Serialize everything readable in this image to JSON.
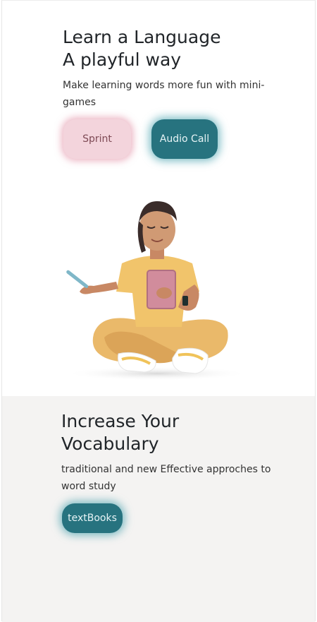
{
  "hero": {
    "title_line1": "Learn a Language",
    "title_line2": "A playful way",
    "subtitle": "Make learning words more fun with mini-games",
    "buttons": {
      "sprint": "Sprint",
      "audio_call": "Audio Call"
    }
  },
  "vocab": {
    "title_line1": "Increase Your",
    "title_line2": "Vocabulary",
    "subtitle": "traditional and new Effective approches to word study",
    "button": "textBooks"
  },
  "colors": {
    "teal": "#27737f",
    "pink": "#f3d4dc",
    "section_bg": "#f4f3f2",
    "text": "#212529"
  }
}
